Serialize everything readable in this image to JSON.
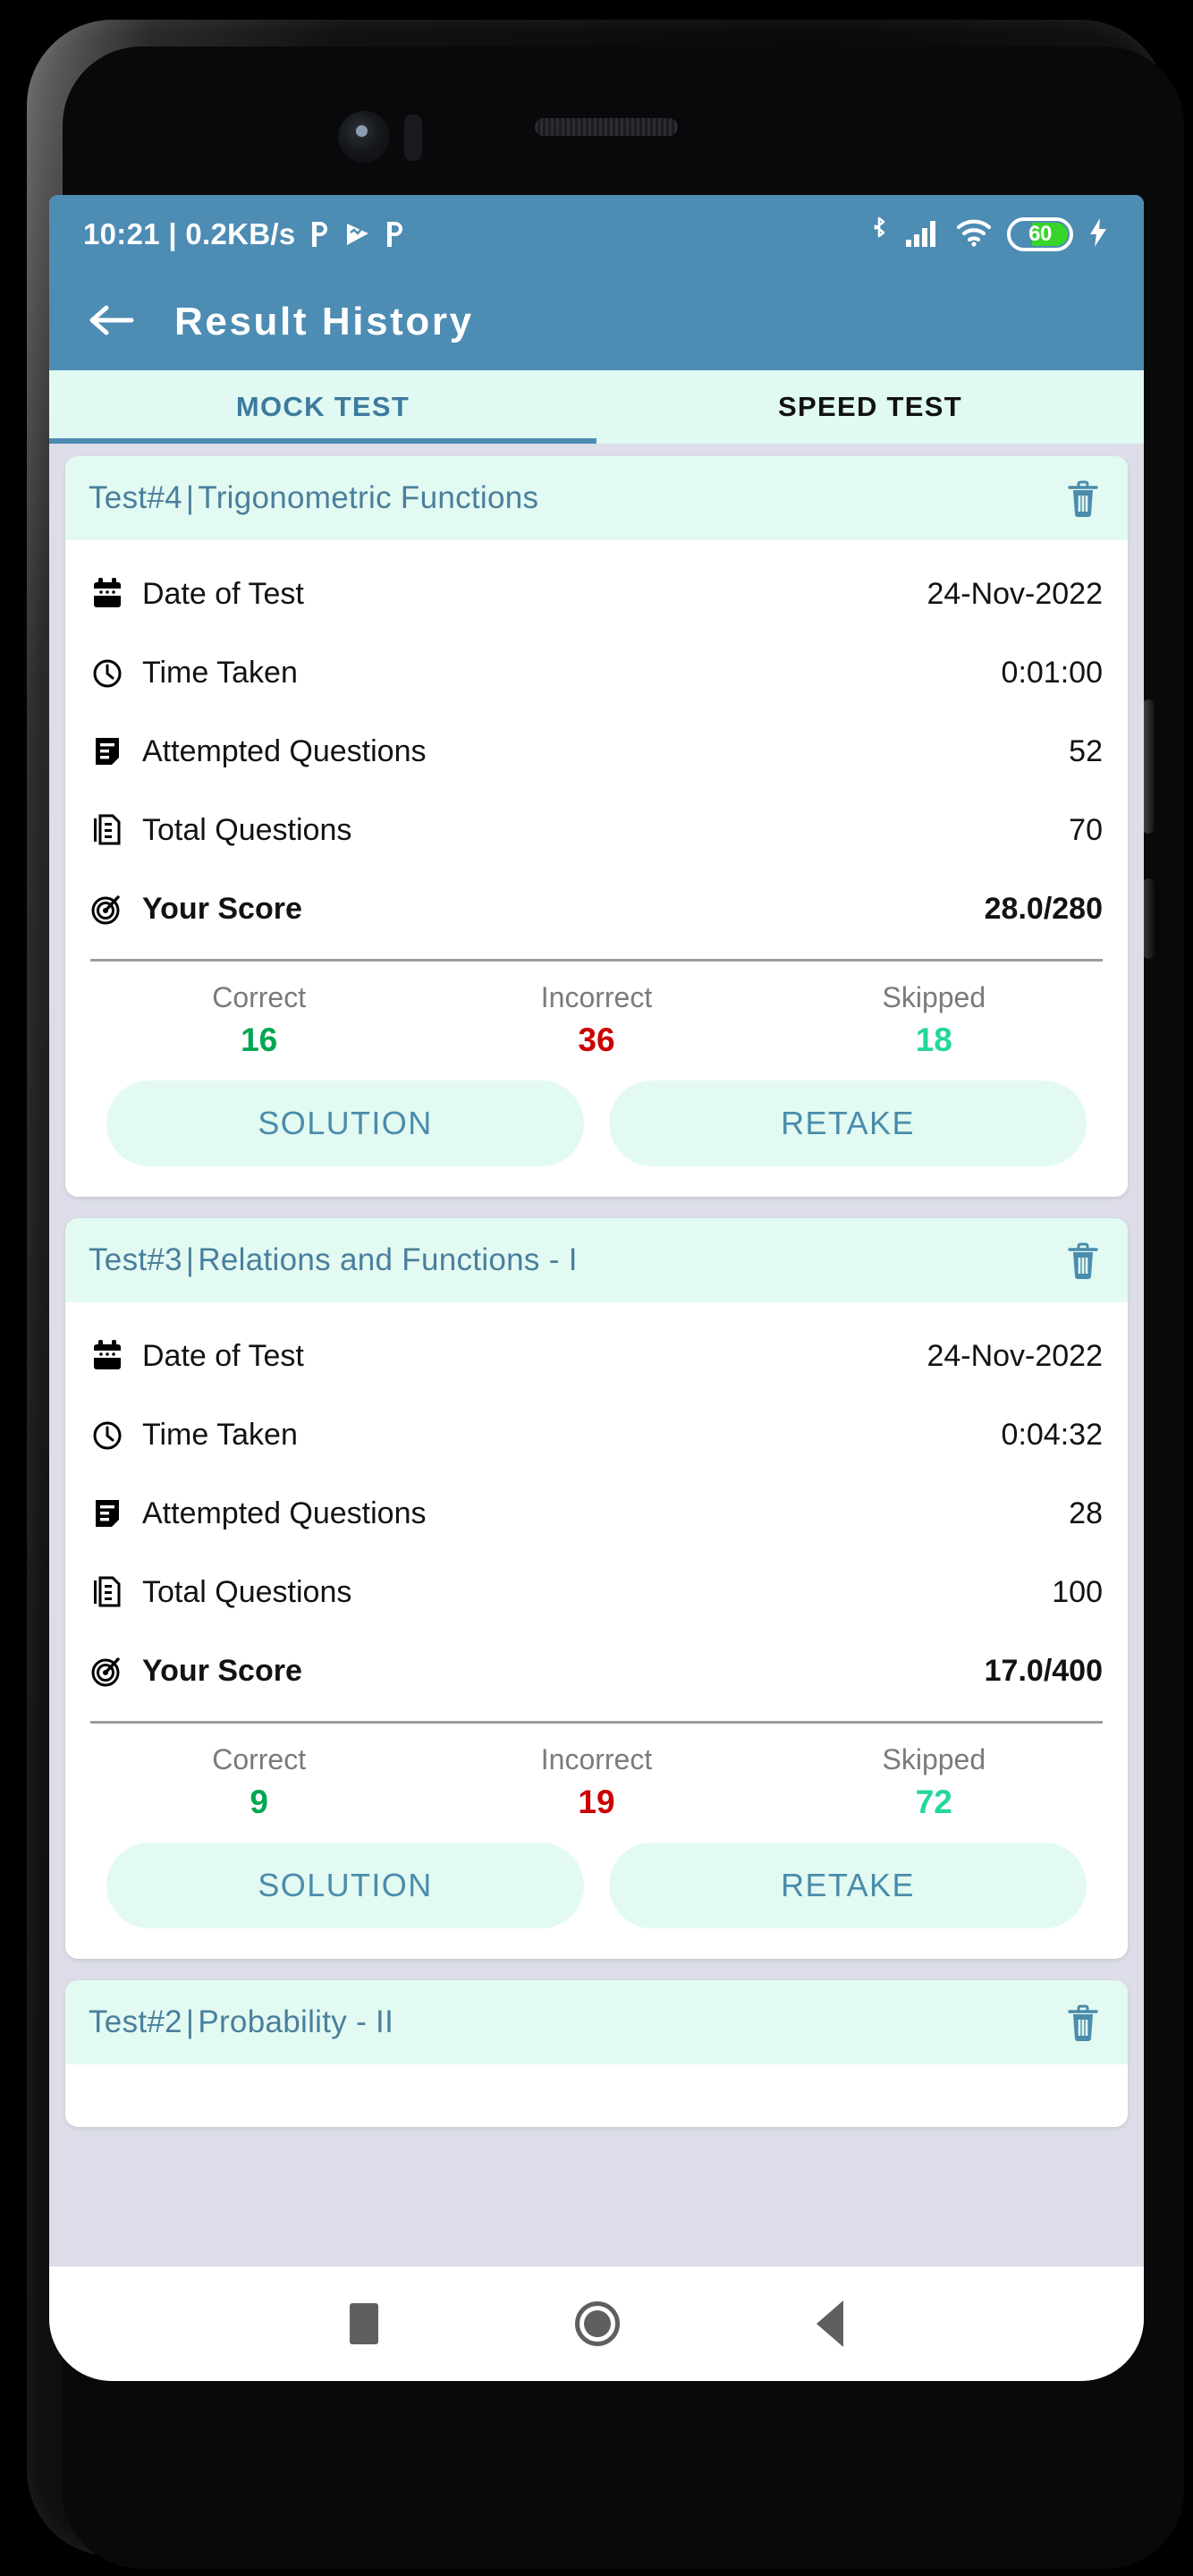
{
  "theme": {
    "accent": "#4d8cb3",
    "card_header_bg": "#e2faf2",
    "page_bg": "#dcdde8",
    "title_color": "#4a7f9c",
    "correct_color": "#00a651",
    "incorrect_color": "#cc0000",
    "skipped_color": "#23d6a0",
    "battery_color": "#37d52a"
  },
  "status_bar": {
    "clock": "10:21",
    "separator": "|",
    "network_speed": "0.2KB/s",
    "notification_icons": [
      "p-app-icon",
      "play-triangle-icon",
      "p-app-icon"
    ],
    "right_icons": [
      "bluetooth-icon",
      "signal-bars-icon",
      "wifi-icon"
    ],
    "battery_percent": "60",
    "battery_level": 60,
    "charging": true
  },
  "app_bar": {
    "back_icon": "back-arrow-icon",
    "title": "Result History"
  },
  "tabs": [
    {
      "label": "MOCK TEST",
      "active": true
    },
    {
      "label": "SPEED TEST",
      "active": false
    }
  ],
  "labels": {
    "date_of_test": "Date of Test",
    "time_taken": "Time Taken",
    "attempted_questions": "Attempted Questions",
    "total_questions": "Total Questions",
    "your_score": "Your Score",
    "correct": "Correct",
    "incorrect": "Incorrect",
    "skipped": "Skipped",
    "solution_button": "SOLUTION",
    "retake_button": "RETAKE",
    "delete_icon": "trash-icon"
  },
  "results": [
    {
      "test_number": "Test#4",
      "separator": "|",
      "topic": "Trigonometric Functions",
      "date_of_test": "24-Nov-2022",
      "time_taken": "0:01:00",
      "attempted_questions": "52",
      "total_questions": "70",
      "your_score": "28.0/280",
      "correct": "16",
      "incorrect": "36",
      "skipped": "18"
    },
    {
      "test_number": "Test#3",
      "separator": "|",
      "topic": "Relations and Functions - I",
      "date_of_test": "24-Nov-2022",
      "time_taken": "0:04:32",
      "attempted_questions": "28",
      "total_questions": "100",
      "your_score": "17.0/400",
      "correct": "9",
      "incorrect": "19",
      "skipped": "72"
    },
    {
      "test_number": "Test#2",
      "separator": "|",
      "topic": "Probability - II",
      "partial": true
    }
  ],
  "nav_bar": {
    "recents": "recents-square-icon",
    "home": "home-circle-icon",
    "back": "back-triangle-icon"
  }
}
